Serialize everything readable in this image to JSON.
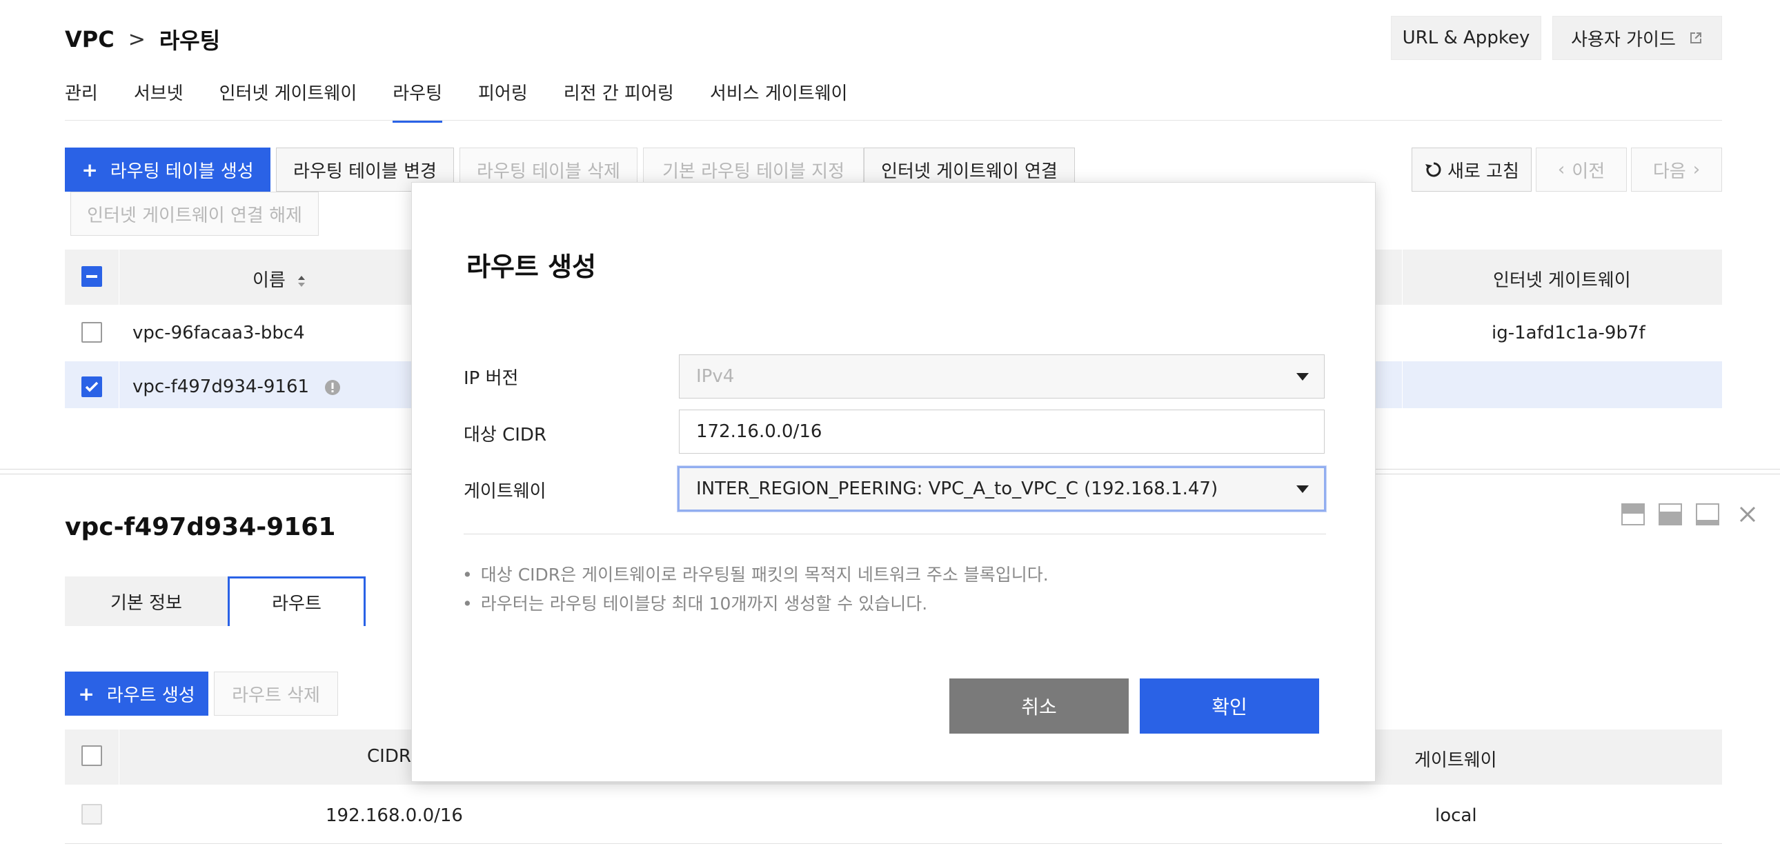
{
  "breadcrumb": {
    "root": "VPC",
    "separator": ">",
    "current": "라우팅"
  },
  "header_buttons": {
    "url_appkey": "URL & Appkey",
    "user_guide": "사용자 가이드"
  },
  "tabs": [
    {
      "label": "관리",
      "active": false
    },
    {
      "label": "서브넷",
      "active": false
    },
    {
      "label": "인터넷 게이트웨이",
      "active": false
    },
    {
      "label": "라우팅",
      "active": true
    },
    {
      "label": "피어링",
      "active": false
    },
    {
      "label": "리전 간 피어링",
      "active": false
    },
    {
      "label": "서비스 게이트웨이",
      "active": false
    }
  ],
  "toolbar": {
    "create_table": "라우팅 테이블 생성",
    "change_table": "라우팅 테이블 변경",
    "delete_table": "라우팅 테이블 삭제",
    "set_default": "기본 라우팅 테이블 지정",
    "connect_igw": "인터넷 게이트웨이 연결",
    "disconnect_igw": "인터넷 게이트웨이 연결 해제",
    "refresh": "새로 고침",
    "prev": "이전",
    "next": "다음"
  },
  "routing_table": {
    "columns": {
      "name": "이름",
      "igw": "인터넷 게이트웨이"
    },
    "rows": [
      {
        "name": "vpc-96facaa3-bbc4",
        "igw": "ig-1afd1c1a-9b7f",
        "checked": false
      },
      {
        "name": "vpc-f497d934-9161",
        "igw": "",
        "checked": true
      }
    ]
  },
  "detail": {
    "title": "vpc-f497d934-9161",
    "tabs": [
      {
        "label": "기본 정보",
        "active": false
      },
      {
        "label": "라우트",
        "active": true
      }
    ],
    "create_route": "라우트 생성",
    "delete_route": "라우트 삭제",
    "columns": {
      "cidr": "CIDR",
      "gateway": "게이트웨이"
    },
    "rows": [
      {
        "cidr": "192.168.0.0/16",
        "gateway": "local"
      }
    ]
  },
  "modal": {
    "title": "라우트 생성",
    "ip_version_label": "IP 버전",
    "ip_version_value": "IPv4",
    "cidr_label": "대상 CIDR",
    "cidr_value": "172.16.0.0/16",
    "gateway_label": "게이트웨이",
    "gateway_value": "INTER_REGION_PEERING: VPC_A_to_VPC_C (192.168.1.47)",
    "notes": [
      "대상 CIDR은 게이트웨이로 라우팅될 패킷의 목적지 네트워크 주소 블록입니다.",
      "라우터는 라우팅 테이블당 최대 10개까지 생성할 수 있습니다."
    ],
    "note_bullet": "•",
    "cancel": "취소",
    "confirm": "확인"
  },
  "colors": {
    "primary": "#2a62e6",
    "cancel": "#7a7a7a",
    "selected_row": "#e8eefb"
  },
  "icons": [
    "plus-icon",
    "external-link-icon",
    "refresh-icon",
    "chevron-left-icon",
    "chevron-right-icon",
    "sort-icon",
    "warning-icon",
    "caret-down-icon",
    "layout-top-icon",
    "layout-middle-icon",
    "layout-bottom-icon",
    "close-icon"
  ]
}
